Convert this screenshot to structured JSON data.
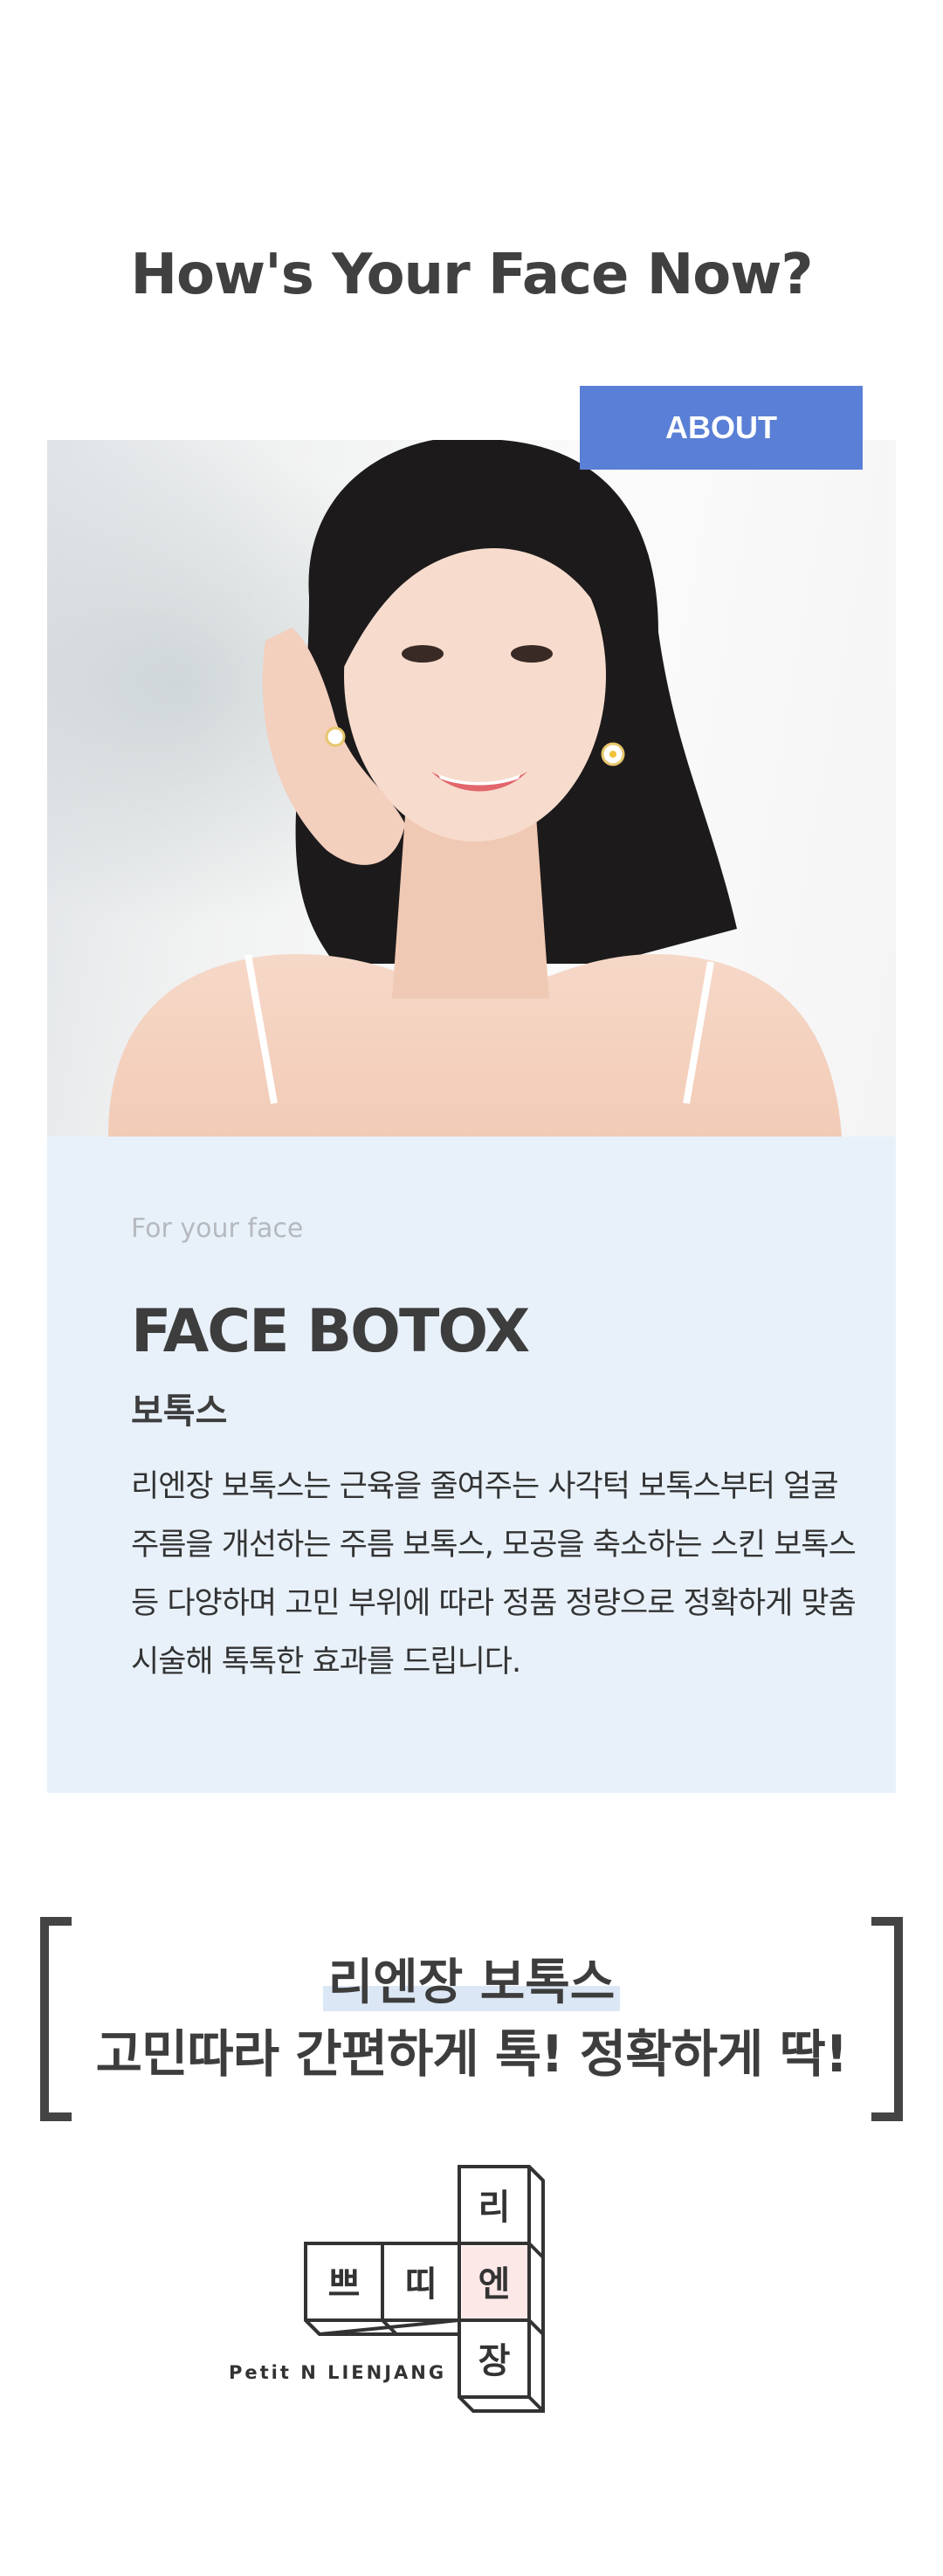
{
  "header": {
    "title": "How's Your Face Now?"
  },
  "about_button": {
    "label": "ABOUT"
  },
  "info": {
    "subtitle": "For your face",
    "title": "FACE BOTOX",
    "korean_title": "보톡스",
    "description": "리엔장 보톡스는 근육을 줄여주는 사각턱 보톡스부터 얼굴 주름을 개선하는 주름 보톡스, 모공을 축소하는 스킨 보톡스 등 다양하며 고민 부위에 따라 정품 정량으로 정확하게 맞춤 시술해 톡톡한 효과를 드립니다."
  },
  "slogan": {
    "line1": "리엔장 보톡스",
    "line2": "고민따라 간편하게 톡! 정확하게 딱!"
  },
  "logo": {
    "blocks": [
      "리",
      "쁘",
      "띠",
      "엔",
      "장"
    ],
    "tagline": "Petit N LIENJANG"
  },
  "colors": {
    "accent": "#5a7fd6",
    "info_bg": "#e8f1fa",
    "logo_highlight": "#fde8e8",
    "text_dark": "#3d3d3d"
  }
}
